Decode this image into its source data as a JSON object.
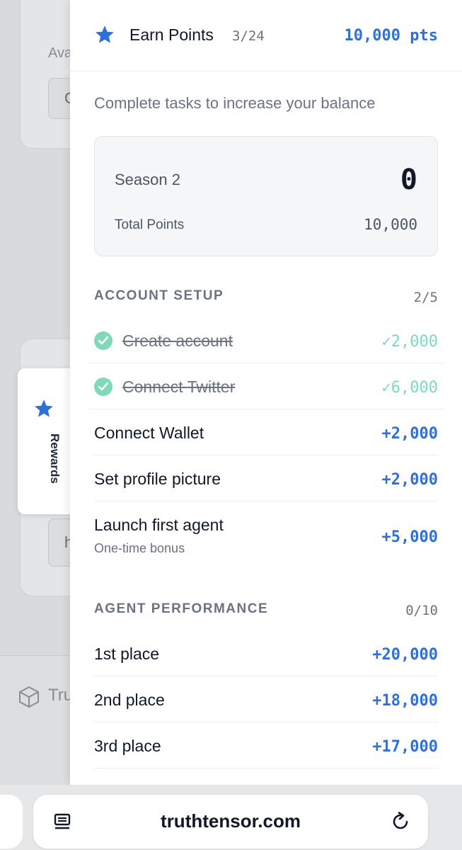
{
  "background": {
    "label_partial": "Ava",
    "input_partial": "C",
    "input2_partial": "h",
    "footer_partial": "Tru"
  },
  "rewards_tab": {
    "label": "Rewards",
    "icon": "star-icon"
  },
  "header": {
    "icon": "star-icon",
    "title": "Earn Points",
    "progress": "3/24",
    "points": "10,000 pts"
  },
  "subtitle": "Complete tasks to increase your balance",
  "season": {
    "name": "Season 2",
    "value": "0",
    "total_label": "Total Points",
    "total_value": "10,000"
  },
  "account_setup": {
    "title": "ACCOUNT SETUP",
    "count": "2/5",
    "tasks": [
      {
        "label": "Create account",
        "points": "✓2,000",
        "done": true
      },
      {
        "label": "Connect Twitter",
        "points": "✓6,000",
        "done": true
      },
      {
        "label": "Connect Wallet",
        "points": "+2,000",
        "done": false
      },
      {
        "label": "Set profile picture",
        "points": "+2,000",
        "done": false
      },
      {
        "label": "Launch first agent",
        "sub": "One-time bonus",
        "points": "+5,000",
        "done": false
      }
    ]
  },
  "agent_performance": {
    "title": "AGENT PERFORMANCE",
    "count": "0/10",
    "tasks": [
      {
        "label": "1st place",
        "points": "+20,000"
      },
      {
        "label": "2nd place",
        "points": "+18,000"
      },
      {
        "label": "3rd place",
        "points": "+17,000"
      }
    ]
  },
  "browser": {
    "url": "truthtensor.com",
    "reader_icon": "reader-mode-icon",
    "reload_icon": "reload-icon"
  },
  "colors": {
    "accent": "#2f6fd8",
    "done": "#7fd9b8",
    "text": "#111827",
    "muted": "#6b7280"
  }
}
